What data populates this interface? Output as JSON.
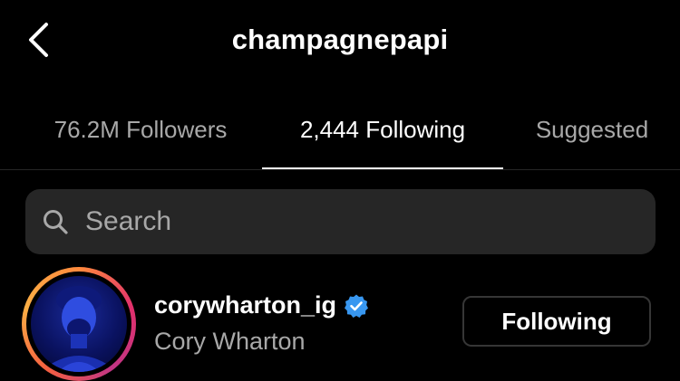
{
  "header": {
    "title": "champagnepapi",
    "back_icon": "chevron-left-icon"
  },
  "tabs": [
    {
      "label": "76.2M Followers",
      "active": false
    },
    {
      "label": "2,444 Following",
      "active": true
    },
    {
      "label": "Suggested",
      "active": false
    }
  ],
  "search": {
    "placeholder": "Search",
    "icon": "search-icon"
  },
  "list": [
    {
      "username": "corywharton_ig",
      "full_name": "Cory Wharton",
      "verified": true,
      "has_story_ring": true,
      "button_label": "Following"
    }
  ],
  "colors": {
    "background": "#000000",
    "text_primary": "#ffffff",
    "text_secondary": "#a8a8a8",
    "search_bg": "#262626",
    "verified_blue": "#3897f0",
    "button_border": "#363636"
  }
}
